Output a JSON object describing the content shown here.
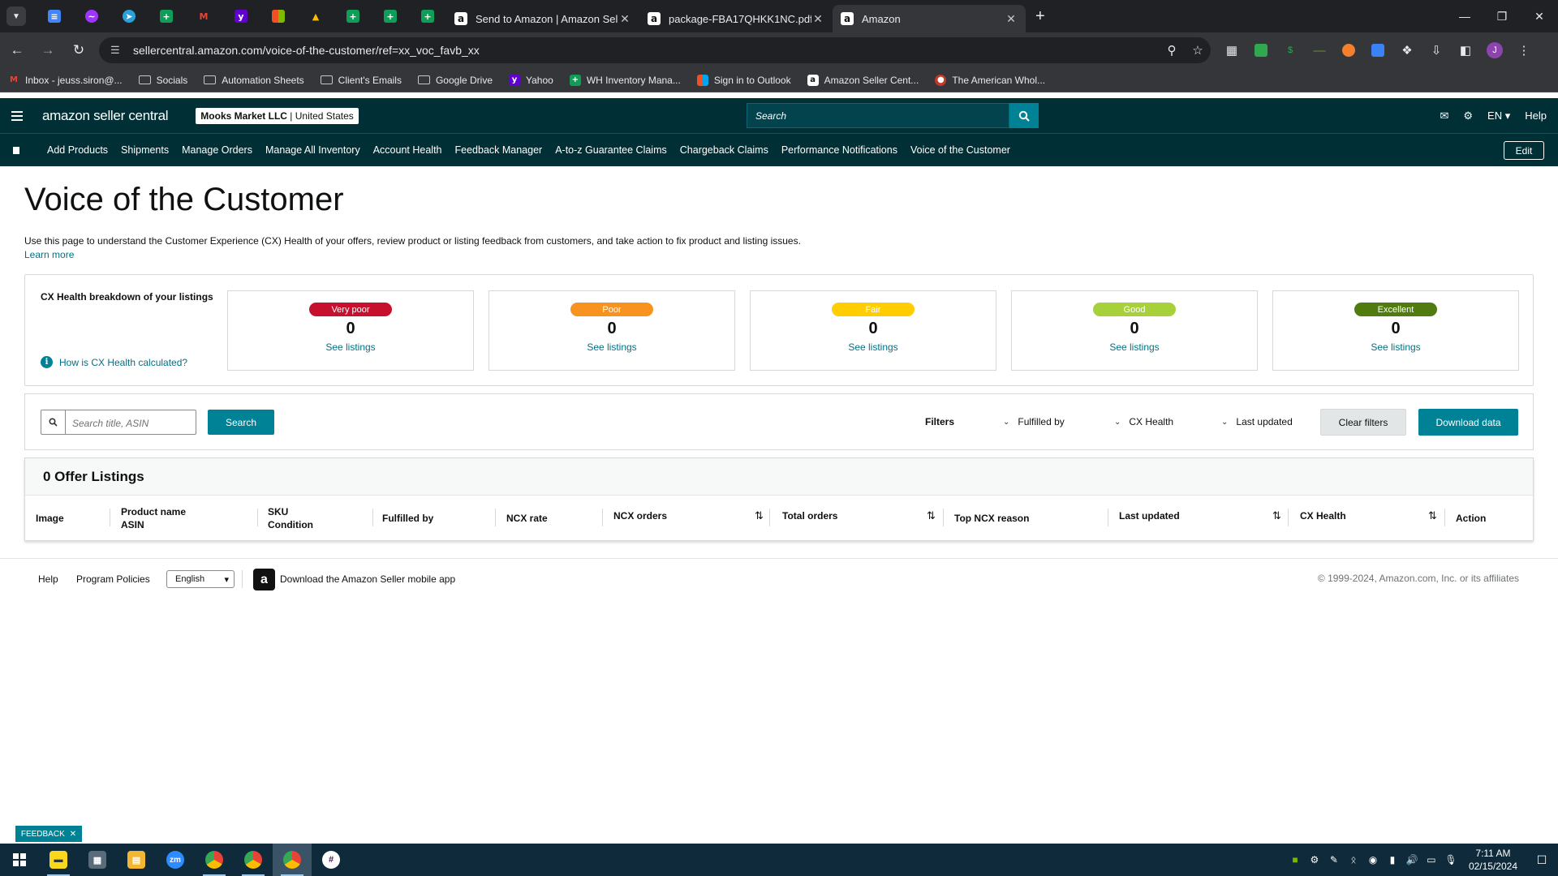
{
  "browser": {
    "tabs": [
      {
        "title": "Send to Amazon | Amazon Selle",
        "active": false
      },
      {
        "title": "package-FBA17QHKK1NC.pdf",
        "active": false
      },
      {
        "title": "Amazon",
        "active": true
      }
    ],
    "pinned_icons": [
      "google-docs",
      "messenger",
      "telegram",
      "google-sheets",
      "gmail",
      "yahoo",
      "microsoft",
      "google-drive",
      "google-sheets",
      "google-sheets",
      "google-sheets"
    ],
    "url": "sellercentral.amazon.com/voice-of-the-customer/ref=xx_voc_favb_xx",
    "profile_initial": "J",
    "bookmarks": [
      {
        "label": "Inbox - jeuss.siron@...",
        "icon": "gmail"
      },
      {
        "label": "Socials",
        "icon": "folder"
      },
      {
        "label": "Automation Sheets",
        "icon": "folder"
      },
      {
        "label": "Client's Emails",
        "icon": "folder"
      },
      {
        "label": "Google Drive",
        "icon": "folder"
      },
      {
        "label": "Yahoo",
        "icon": "yahoo"
      },
      {
        "label": "WH Inventory Mana...",
        "icon": "google-sheets"
      },
      {
        "label": "Sign in to Outlook",
        "icon": "microsoft"
      },
      {
        "label": "Amazon Seller Cent...",
        "icon": "amazon"
      },
      {
        "label": "The American Whol...",
        "icon": "site"
      }
    ]
  },
  "header": {
    "logo": "amazon seller central",
    "store_name": "Mooks Market LLC",
    "store_region": "United States",
    "search_placeholder": "Search",
    "language": "EN",
    "help": "Help"
  },
  "nav": {
    "items": [
      "Add Products",
      "Shipments",
      "Manage Orders",
      "Manage All Inventory",
      "Account Health",
      "Feedback Manager",
      "A-to-z Guarantee Claims",
      "Chargeback Claims",
      "Performance Notifications",
      "Voice of the Customer"
    ],
    "edit_label": "Edit"
  },
  "page": {
    "title": "Voice of the Customer",
    "description": "Use this page to understand the Customer Experience (CX) Health of your offers, review product or listing feedback from customers, and take action to fix product and listing issues.",
    "learn_more": "Learn more"
  },
  "cx_health": {
    "title": "CX Health breakdown of your listings",
    "how_link": "How is CX Health calculated?",
    "cards": [
      {
        "label": "Very poor",
        "count": "0",
        "link": "See listings",
        "color": "#c7102e"
      },
      {
        "label": "Poor",
        "count": "0",
        "link": "See listings",
        "color": "#f7931e"
      },
      {
        "label": "Fair",
        "count": "0",
        "link": "See listings",
        "color": "#ffcd00"
      },
      {
        "label": "Good",
        "count": "0",
        "link": "See listings",
        "color": "#a7d13b"
      },
      {
        "label": "Excellent",
        "count": "0",
        "link": "See listings",
        "color": "#507c0f"
      }
    ]
  },
  "filters": {
    "search_placeholder": "Search title, ASIN",
    "search_button": "Search",
    "filters_label": "Filters",
    "dropdowns": [
      "Fulfilled by",
      "CX Health",
      "Last updated"
    ],
    "clear_button": "Clear filters",
    "download_button": "Download data"
  },
  "table": {
    "title": "0 Offer Listings",
    "columns": [
      {
        "line1": "Image",
        "line2": ""
      },
      {
        "line1": "Product name",
        "line2": "ASIN"
      },
      {
        "line1": "SKU",
        "line2": "Condition"
      },
      {
        "line1": "Fulfilled by",
        "line2": ""
      },
      {
        "line1": "NCX rate",
        "line2": ""
      },
      {
        "line1": "NCX orders",
        "line2": ""
      },
      {
        "line1": "Total orders",
        "line2": ""
      },
      {
        "line1": "Top NCX reason",
        "line2": ""
      },
      {
        "line1": "Last updated",
        "line2": ""
      },
      {
        "line1": "CX Health",
        "line2": ""
      },
      {
        "line1": "Action",
        "line2": ""
      }
    ]
  },
  "footer": {
    "help": "Help",
    "policies": "Program Policies",
    "language": "English",
    "app_link": "Download the Amazon Seller mobile app",
    "copyright": "© 1999-2024, Amazon.com, Inc. or its affiliates"
  },
  "feedback_tab": "FEEDBACK",
  "taskbar": {
    "time": "7:11 AM",
    "date": "02/15/2024"
  }
}
